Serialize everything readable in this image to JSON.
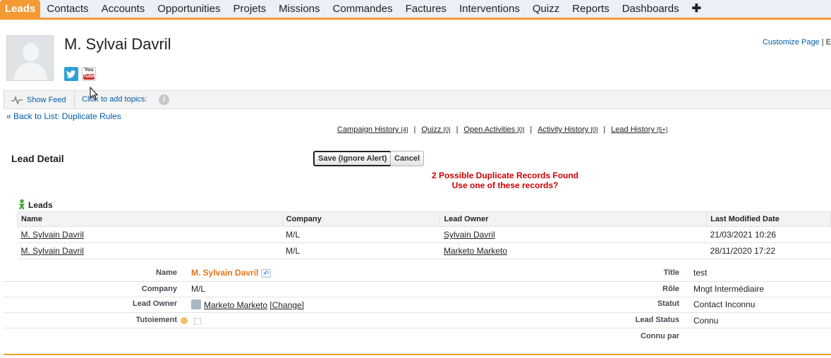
{
  "tabs": [
    {
      "label": "Leads",
      "active": true
    },
    {
      "label": "Contacts"
    },
    {
      "label": "Accounts"
    },
    {
      "label": "Opportunities"
    },
    {
      "label": "Projets"
    },
    {
      "label": "Missions"
    },
    {
      "label": "Commandes"
    },
    {
      "label": "Factures"
    },
    {
      "label": "Interventions"
    },
    {
      "label": "Quizz"
    },
    {
      "label": "Reports"
    },
    {
      "label": "Dashboards"
    },
    {
      "label": "✚"
    }
  ],
  "header": {
    "title": "M. Sylvai Davril",
    "customize_link": "Customize Page",
    "customize_sep": " | E",
    "social": {
      "twitter_icon": "twitter-icon",
      "youtube_top": "You",
      "youtube_bottom": "Tube"
    }
  },
  "feed": {
    "show_feed": "Show Feed",
    "topics": "Click to add topics:",
    "info_glyph": "i"
  },
  "back_link": "« Back to List: Duplicate Rules",
  "related_links": [
    {
      "label": "Campaign History",
      "count": "[4]"
    },
    {
      "label": "Quizz",
      "count": "[0]"
    },
    {
      "label": "Open Activities",
      "count": "[0]"
    },
    {
      "label": "Activity History",
      "count": "[0]"
    },
    {
      "label": "Lead History",
      "count": "[5+]"
    }
  ],
  "detail": {
    "section_title": "Lead Detail",
    "save_button": "Save (Ignore Alert)",
    "cancel_button": "Cancel",
    "dup_line1": "2 Possible Duplicate Records Found",
    "dup_line2": "Use one of these records?"
  },
  "leads_table": {
    "title": "Leads",
    "columns": [
      "Name",
      "Company",
      "Lead Owner",
      "Last Modified Date"
    ],
    "rows": [
      [
        "M. Sylvain Davril",
        "M/L",
        "Sylvain Davril",
        "21/03/2021 10:26"
      ],
      [
        "M. Sylvain Davril",
        "M/L",
        "Marketo Marketo",
        "28/11/2020 17:22"
      ]
    ]
  },
  "fields": {
    "name_label": "Name",
    "name_value": "M. Sylvain Davril",
    "title_label": "Title",
    "title_value": "test",
    "company_label": "Company",
    "company_value": "M/L",
    "role_label": "Rôle",
    "role_value": "Mngt Intermédiaire",
    "owner_label": "Lead Owner",
    "owner_value": "Marketo Marketo",
    "owner_change": "[Change]",
    "statut_label": "Statut",
    "statut_value": "Contact Inconnu",
    "tutoiement_label": "Tutoiement",
    "lead_status_label": "Lead Status",
    "lead_status_value": "Connu",
    "connu_par_label": "Connu par"
  },
  "colors": {
    "accent": "#f39a32",
    "link": "#015ba7",
    "alert": "#cc0000",
    "name_orange": "#e8741a"
  }
}
